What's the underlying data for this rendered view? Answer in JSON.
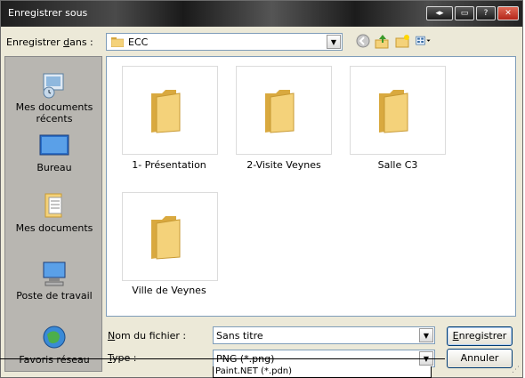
{
  "window": {
    "title": "Enregistrer sous",
    "buttons": [
      "◂▸",
      "▭",
      "?",
      "✕"
    ]
  },
  "toolbar": {
    "save_in_label_pre": "Enregistrer ",
    "save_in_label_u": "d",
    "save_in_label_post": "ans :",
    "current_folder": "ECC",
    "icons": [
      "back-icon",
      "up-folder-icon",
      "new-folder-icon",
      "views-menu-icon"
    ]
  },
  "places": [
    {
      "label": "Mes documents récents",
      "icon": "recent-documents-icon"
    },
    {
      "label": "Bureau",
      "icon": "desktop-icon"
    },
    {
      "label": "Mes documents",
      "icon": "my-documents-icon"
    },
    {
      "label": "Poste de travail",
      "icon": "my-computer-icon"
    },
    {
      "label": "Favoris réseau",
      "icon": "network-places-icon"
    }
  ],
  "files": [
    {
      "name": "1- Présentation",
      "type": "folder"
    },
    {
      "name": "2-Visite Veynes",
      "type": "folder"
    },
    {
      "name": "Salle C3",
      "type": "folder"
    },
    {
      "name": "Ville de Veynes",
      "type": "folder"
    }
  ],
  "filename": {
    "label_u": "N",
    "label_rest": "om du fichier :",
    "value": "Sans titre"
  },
  "filetype": {
    "label_u": "T",
    "label_rest": "ype :",
    "value": "PNG (*.png)",
    "dropdown_option": "Paint.NET (*.pdn)"
  },
  "actions": {
    "save_u": "E",
    "save_rest": "nregistrer",
    "cancel": "Annuler"
  },
  "colors": {
    "folder": "#f4d27a",
    "folder_dark": "#d9a93f",
    "accent": "#7f9db9"
  }
}
